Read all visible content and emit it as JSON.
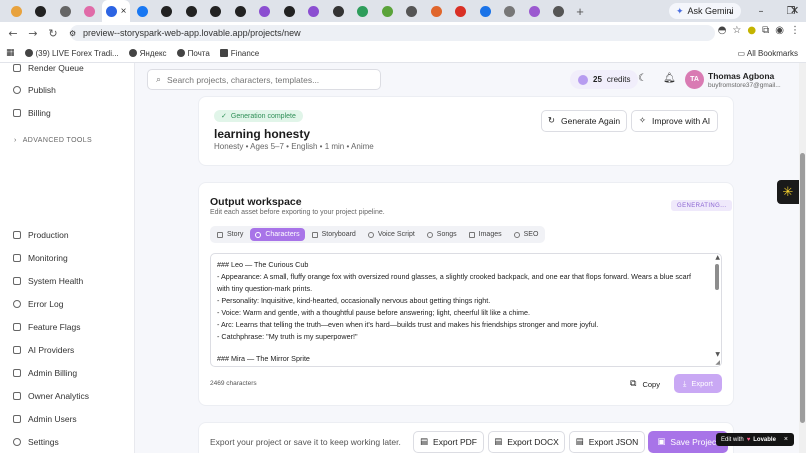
{
  "browser": {
    "tab_favicons": [
      {
        "name": "chrome-icon",
        "color": "#e8a23d"
      },
      {
        "name": "github-icon",
        "color": "#222222"
      },
      {
        "name": "site-icon",
        "color": "#666666"
      },
      {
        "name": "lovable-icon",
        "color": "#e06ba8"
      },
      {
        "name": "meta-icon",
        "color": "#2c64e3"
      },
      {
        "name": "facebook-icon",
        "color": "#1877f2"
      },
      {
        "name": "record-icon",
        "color": "#222222"
      },
      {
        "name": "record-icon",
        "color": "#222222"
      },
      {
        "name": "record-icon",
        "color": "#222222"
      },
      {
        "name": "record-icon",
        "color": "#222222"
      },
      {
        "name": "purple-icon",
        "color": "#8b4ed1"
      },
      {
        "name": "record-icon",
        "color": "#222222"
      },
      {
        "name": "purple-icon",
        "color": "#8b4ed1"
      },
      {
        "name": "openai-icon",
        "color": "#333333"
      },
      {
        "name": "green-icon",
        "color": "#2e9d5b"
      },
      {
        "name": "green-icon",
        "color": "#5aa33a"
      },
      {
        "name": "site-icon",
        "color": "#555555"
      },
      {
        "name": "orange-icon",
        "color": "#e0662c"
      },
      {
        "name": "gmail-icon",
        "color": "#d93025"
      },
      {
        "name": "blue-icon",
        "color": "#1a73e8"
      },
      {
        "name": "grey-icon",
        "color": "#777777"
      },
      {
        "name": "purple-icon",
        "color": "#9b59d0"
      },
      {
        "name": "site-icon",
        "color": "#555555"
      }
    ],
    "ask_gemini": "Ask Gemini",
    "url": "preview--storyspark-web-app.lovable.app/projects/new",
    "bookmarks": [
      {
        "label": "(39) LIVE Forex Tradi..."
      },
      {
        "label": "Яндекс"
      },
      {
        "label": "Почта"
      },
      {
        "label": "Finance"
      }
    ],
    "all_bookmarks": "All Bookmarks"
  },
  "sidebar": {
    "top_items": [
      {
        "label": "Render Queue",
        "icon": "queue-icon"
      },
      {
        "label": "Publish",
        "icon": "share-icon"
      },
      {
        "label": "Billing",
        "icon": "billing-icon"
      }
    ],
    "advanced_label": "ADVANCED TOOLS",
    "admin_items": [
      {
        "label": "Production",
        "icon": "production-icon"
      },
      {
        "label": "Monitoring",
        "icon": "monitoring-icon"
      },
      {
        "label": "System Health",
        "icon": "health-icon"
      },
      {
        "label": "Error Log",
        "icon": "error-icon"
      },
      {
        "label": "Feature Flags",
        "icon": "flag-icon"
      },
      {
        "label": "AI Providers",
        "icon": "ai-icon"
      },
      {
        "label": "Admin Billing",
        "icon": "billing-icon"
      },
      {
        "label": "Owner Analytics",
        "icon": "analytics-icon"
      },
      {
        "label": "Admin Users",
        "icon": "users-icon"
      },
      {
        "label": "Settings",
        "icon": "gear-icon"
      }
    ]
  },
  "header": {
    "search_placeholder": "Search projects, characters, templates...",
    "credits_count": "25",
    "credits_label": "credits",
    "avatar_initials": "TA",
    "user_name": "Thomas Agbona",
    "user_email": "buyfromstore37@gmail..."
  },
  "project": {
    "status": "Generation complete",
    "title": "learning honesty",
    "meta": "Honesty • Ages 5–7 • English • 1 min • Anime",
    "generate_again": "Generate Again",
    "improve": "Improve with AI"
  },
  "workspace": {
    "title": "Output workspace",
    "subtitle": "Edit each asset before exporting to your project pipeline.",
    "status": "GENERATING...",
    "tabs": [
      {
        "label": "Story",
        "active": false
      },
      {
        "label": "Characters",
        "active": true
      },
      {
        "label": "Storyboard",
        "active": false
      },
      {
        "label": "Voice Script",
        "active": false
      },
      {
        "label": "Songs",
        "active": false
      },
      {
        "label": "Images",
        "active": false
      },
      {
        "label": "SEO",
        "active": false
      }
    ],
    "lines": [
      "### Leo — The Curious Cub",
      "- Appearance: A small, fluffy orange fox with oversized round glasses, a slightly crooked backpack, and one ear that flops forward. Wears a blue scarf",
      "with tiny question-mark prints.",
      "- Personality: Inquisitive, kind-hearted, occasionally nervous about getting things right.",
      "- Voice: Warm and gentle, with a thoughtful pause before answering; light, cheerful lilt like a chime.",
      "- Arc: Learns that telling the truth—even when it's hard—builds trust and makes his friendships stronger and more joyful.",
      "- Catchphrase: \"My truth is my superpower!\"",
      "",
      "### Mira — The Mirror Sprite"
    ],
    "char_count": "2469 characters",
    "copy": "Copy",
    "export": "Export"
  },
  "footer": {
    "text": "Export your project or save it to keep working later.",
    "export_pdf": "Export PDF",
    "export_docx": "Export DOCX",
    "export_json": "Export JSON",
    "save": "Save Project"
  },
  "lovable_badge": {
    "prefix": "Edit with",
    "brand": "Lovable",
    "close": "×"
  },
  "colors": {
    "accent": "#a874e8",
    "success": "#2f8f57"
  }
}
